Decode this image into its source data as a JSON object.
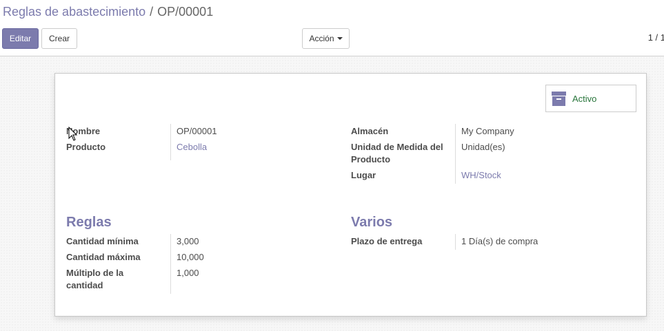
{
  "breadcrumb": {
    "parent": "Reglas de abastecimiento",
    "separator": "/",
    "current": "OP/00001"
  },
  "toolbar": {
    "edit_label": "Editar",
    "create_label": "Crear",
    "action_label": "Acción",
    "pager": "1 / 1"
  },
  "status_button": {
    "label": "Activo",
    "icon": "archive-icon"
  },
  "left_fields": [
    {
      "label": "Nombre",
      "value": "OP/00001"
    },
    {
      "label": "Producto",
      "value": "Cebolla"
    }
  ],
  "right_fields": [
    {
      "label": "Almacén",
      "value": "My Company"
    },
    {
      "label": "Unidad de Medida del Producto",
      "value": "Unidad(es)"
    },
    {
      "label": "Lugar",
      "value": "WH/Stock"
    }
  ],
  "rules_section": {
    "title": "Reglas",
    "fields": [
      {
        "label": "Cantidad mínima",
        "value": "3,000"
      },
      {
        "label": "Cantidad máxima",
        "value": "10,000"
      },
      {
        "label": "Múltiplo de la cantidad",
        "value": "1,000"
      }
    ]
  },
  "misc_section": {
    "title": "Varios",
    "fields": [
      {
        "label": "Plazo de entrega",
        "value_number": "1",
        "value_unit": "Día(s) de compra"
      }
    ]
  },
  "colors": {
    "brand": "#7c7bad",
    "active_green": "#28753b"
  }
}
